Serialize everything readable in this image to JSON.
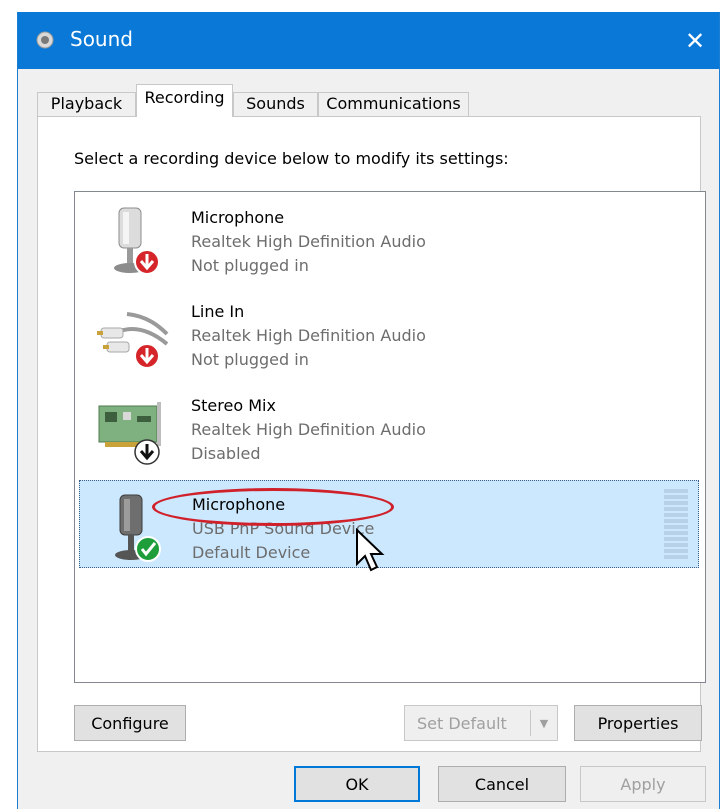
{
  "window": {
    "title": "Sound",
    "close_glyph": "✕",
    "accent_color": "#0a78d7"
  },
  "tabs": [
    {
      "label": "Playback",
      "active": false
    },
    {
      "label": "Recording",
      "active": true
    },
    {
      "label": "Sounds",
      "active": false
    },
    {
      "label": "Communications",
      "active": false
    }
  ],
  "panel": {
    "instruction": "Select a recording device below to modify its settings:"
  },
  "devices": [
    {
      "name": "Microphone",
      "driver": "Realtek High Definition Audio",
      "status": "Not plugged in",
      "icon": "microphone-icon",
      "badge": "red-down-arrow-badge"
    },
    {
      "name": "Line In",
      "driver": "Realtek High Definition Audio",
      "status": "Not plugged in",
      "icon": "rca-cable-icon",
      "badge": "red-down-arrow-badge"
    },
    {
      "name": "Stereo Mix",
      "driver": "Realtek High Definition Audio",
      "status": "Disabled",
      "icon": "sound-card-icon",
      "badge": "black-down-arrow-badge"
    },
    {
      "name": "Microphone",
      "driver": "USB PnP Sound Device",
      "status": "Default Device",
      "icon": "microphone-icon",
      "badge": "green-check-badge",
      "selected": true
    }
  ],
  "buttons": {
    "configure": "Configure",
    "set_default": "Set Default",
    "set_default_arrow": "▼",
    "properties": "Properties",
    "ok": "OK",
    "cancel": "Cancel",
    "apply": "Apply"
  },
  "colors": {
    "selection": "#cce8ff",
    "annotation": "#d0202a",
    "badge_red": "#d6252a",
    "badge_green": "#1e9e3a"
  }
}
